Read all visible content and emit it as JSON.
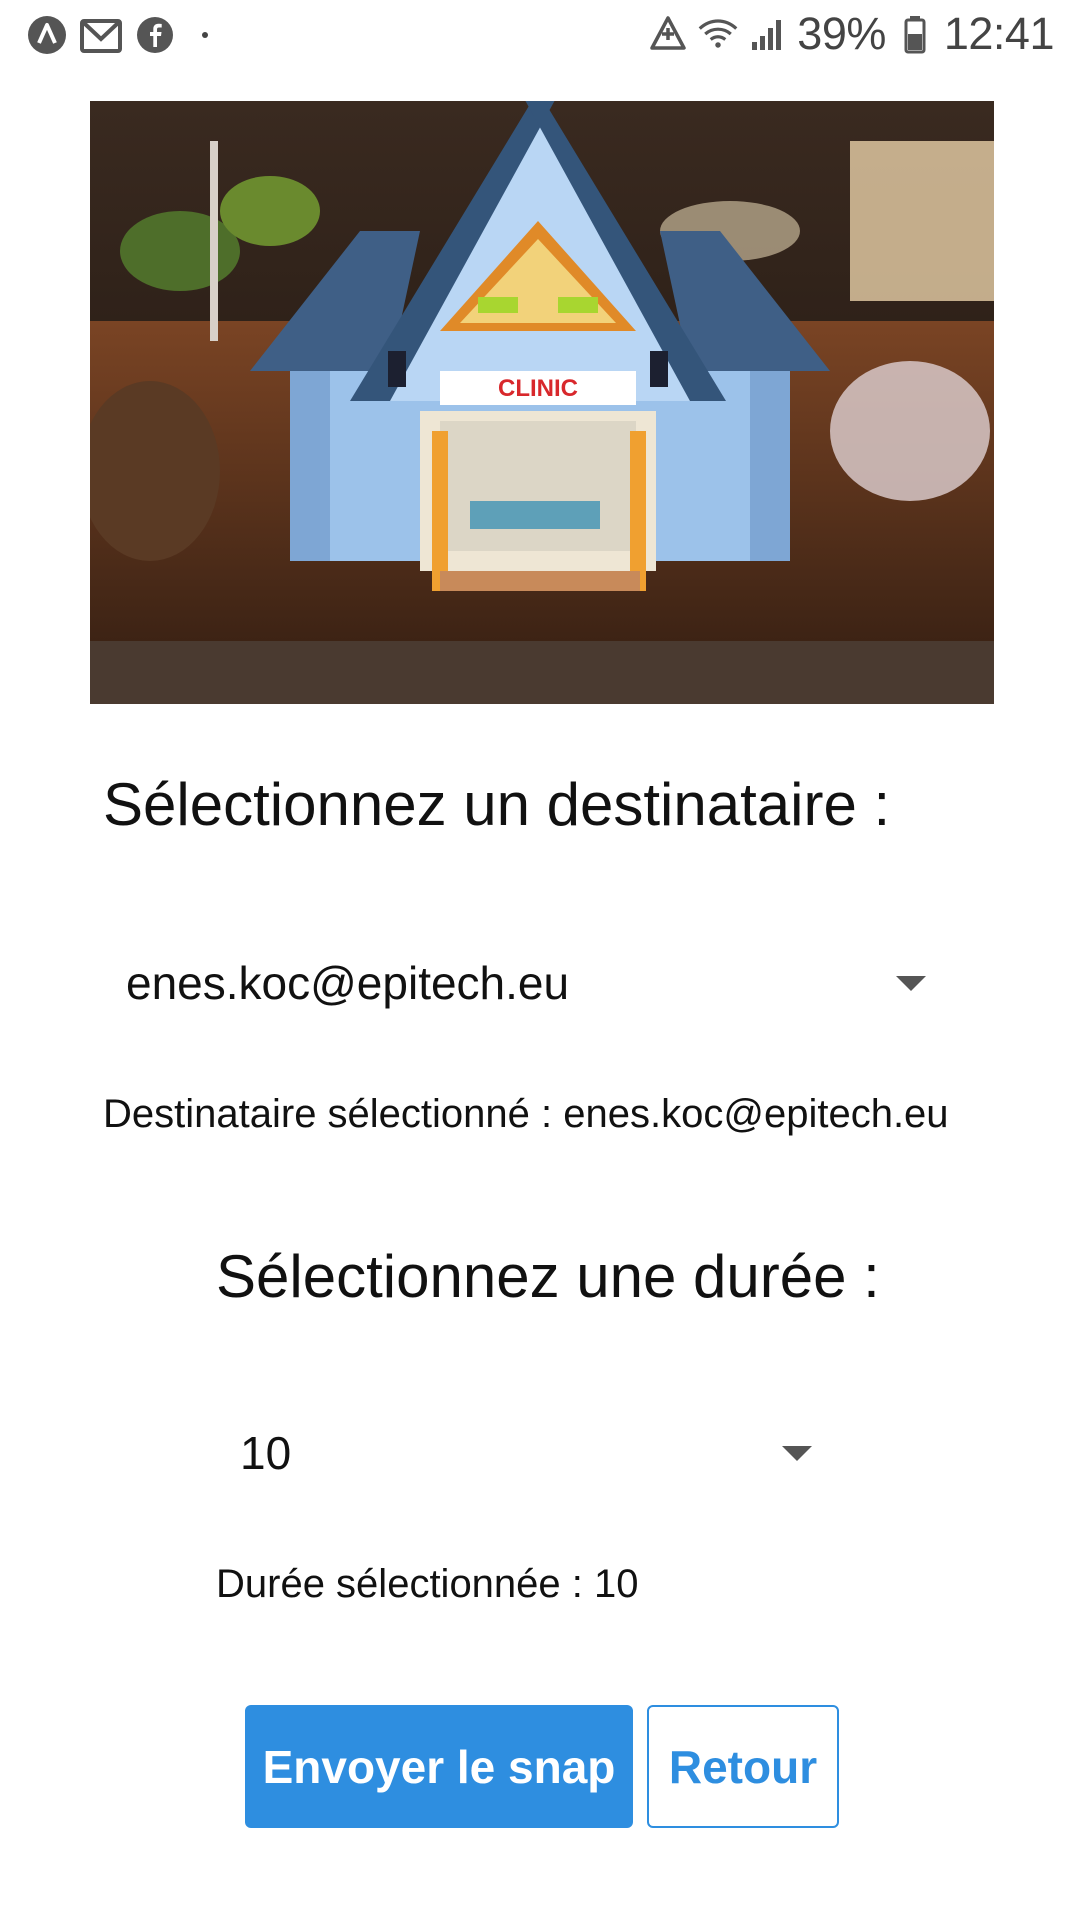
{
  "status_bar": {
    "battery_percent": "39%",
    "time": "12:41",
    "icons_left": [
      "app-a-icon",
      "gmail-icon",
      "facebook-icon",
      "dot-icon"
    ],
    "icons_right": [
      "data-saver-icon",
      "wifi-icon",
      "signal-icon",
      "battery-icon"
    ]
  },
  "photo": {
    "sign_text": "CLINIC"
  },
  "recipient": {
    "heading": "Sélectionnez un destinataire :",
    "selected_value": "enes.koc@epitech.eu",
    "selected_text": "Destinataire sélectionné : enes.koc@epitech.eu"
  },
  "duration": {
    "heading": "Sélectionnez une durée :",
    "selected_value": "10",
    "selected_text": "Durée sélectionnée : 10"
  },
  "actions": {
    "send_label": "Envoyer le snap",
    "back_label": "Retour"
  },
  "colors": {
    "accent": "#2e8ee0",
    "text": "#111111"
  }
}
